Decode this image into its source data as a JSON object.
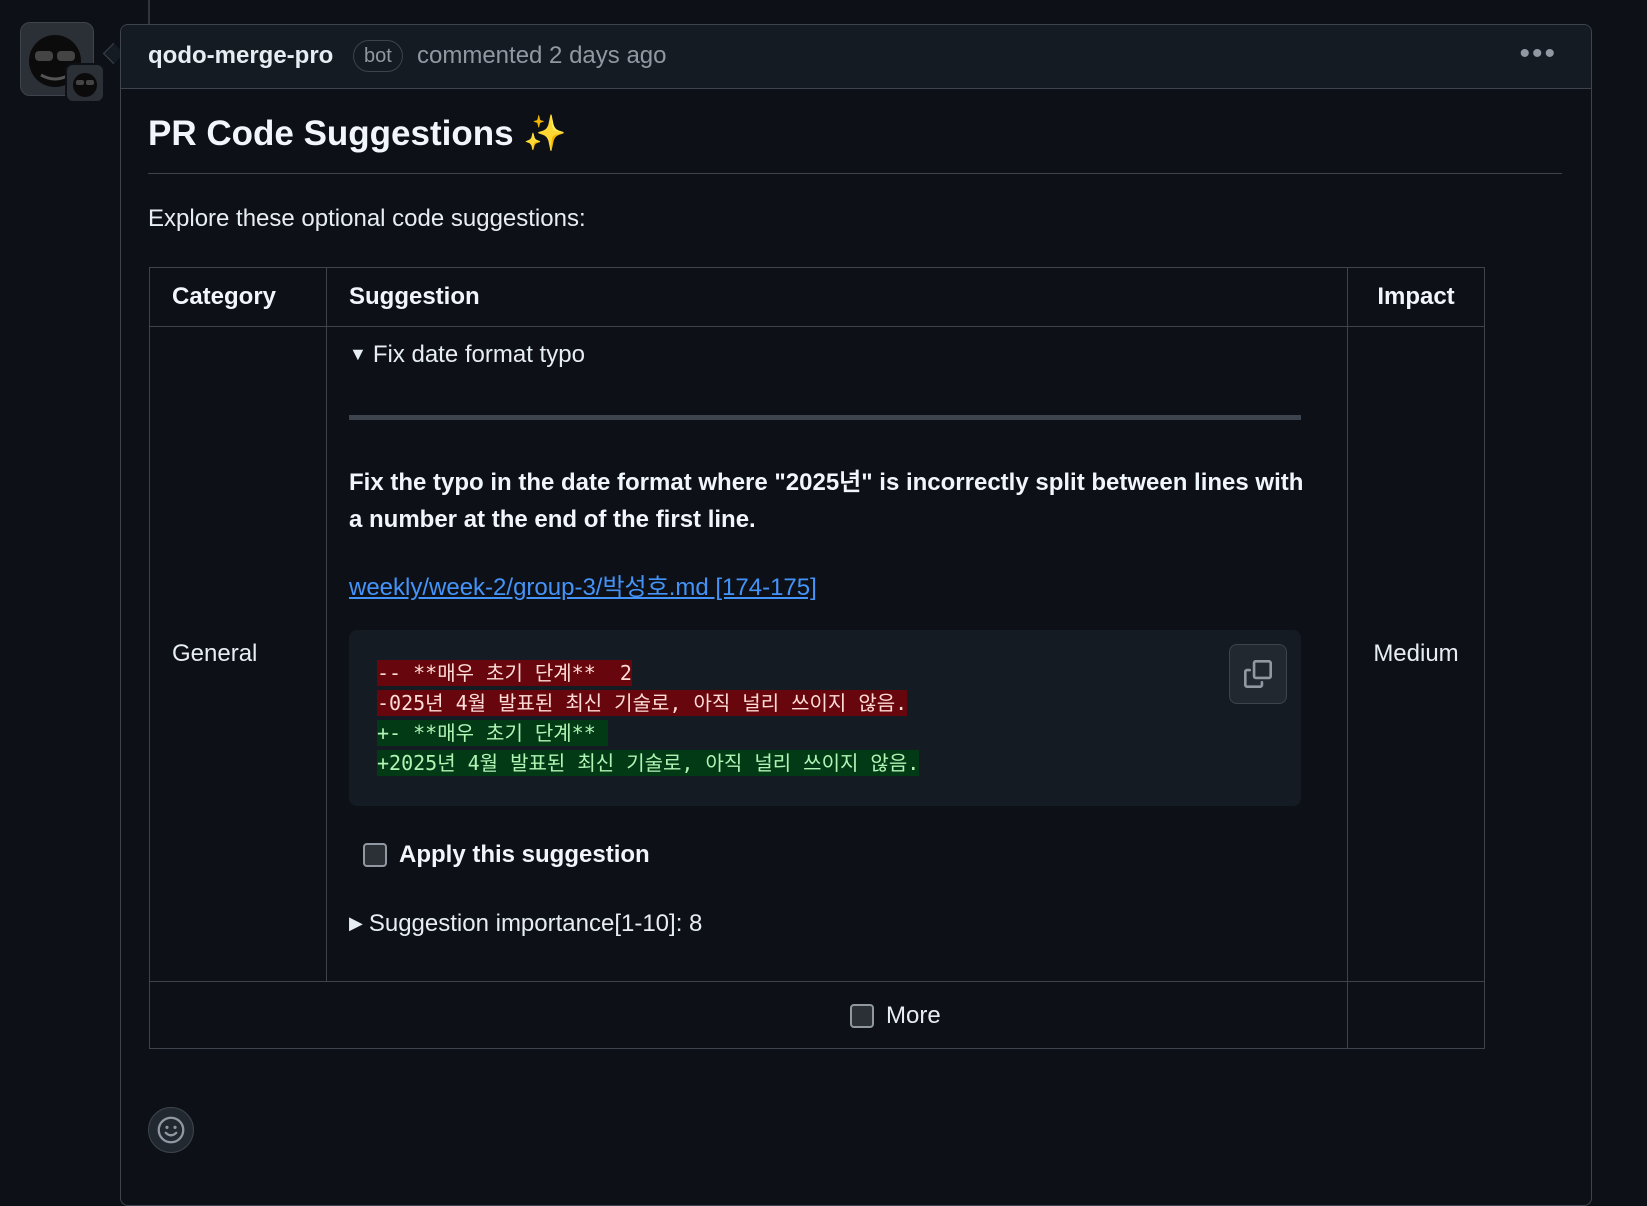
{
  "comment": {
    "author": "qodo-merge-pro",
    "badge": "bot",
    "meta": "commented 2 days ago",
    "menu_icon": "kebab-horizontal-icon"
  },
  "content": {
    "title": "PR Code Suggestions",
    "title_icon": "✨",
    "intro": "Explore these optional code suggestions:"
  },
  "table": {
    "headers": {
      "category": "Category",
      "suggestion": "Suggestion",
      "impact": "Impact"
    },
    "rows": [
      {
        "category": "General",
        "impact": "Medium",
        "summary": "Fix date format typo",
        "description": "Fix the typo in the date format where \"2025년\" is incorrectly split between lines with a number at the end of the first line.",
        "link": "weekly/week-2/group-3/박성호.md [174-175]",
        "diff": [
          {
            "type": "del",
            "text": "-- **매우 초기 단계**  2"
          },
          {
            "type": "del",
            "text": "-025년 4월 발표된 최신 기술로, 아직 널리 쓰이지 않음."
          },
          {
            "type": "add",
            "text": "+- **매우 초기 단계** "
          },
          {
            "type": "add",
            "text": "+2025년 4월 발표된 최신 기술로, 아직 널리 쓰이지 않음."
          }
        ],
        "apply_label": "Apply this suggestion",
        "importance": "Suggestion importance[1-10]: 8"
      }
    ],
    "more_label": "More"
  },
  "colors": {
    "background": "#0d1117",
    "link": "#4493f8",
    "diff_deleted": "#67060c",
    "diff_added": "#033a16"
  }
}
